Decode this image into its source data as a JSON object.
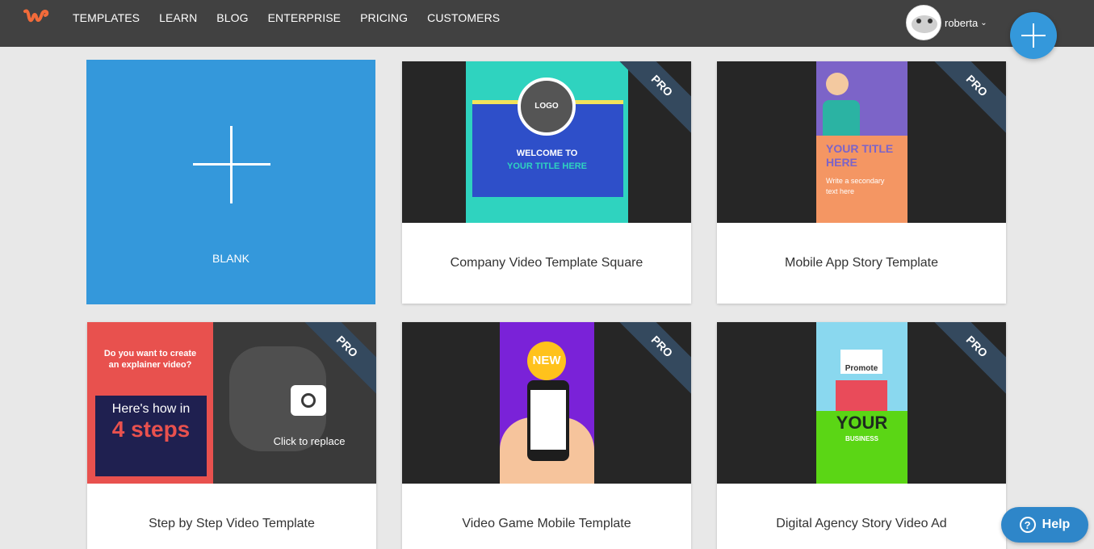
{
  "nav": {
    "items": [
      "TEMPLATES",
      "LEARN",
      "BLOG",
      "ENTERPRISE",
      "PRICING",
      "CUSTOMERS"
    ],
    "user": "roberta"
  },
  "icons": {
    "logo": "waymark-logo-icon",
    "create": "plus-icon",
    "help": "question-circle-icon"
  },
  "colors": {
    "topbar": "#414141",
    "accent": "#3498db",
    "ribbon": "#34495e",
    "logo": "#f26b3a"
  },
  "cards": {
    "blank": {
      "label": "BLANK"
    },
    "company": {
      "label": "Company Video Template Square",
      "badge": "PRO",
      "title1": "WELCOME TO",
      "title2": "YOUR TITLE HERE",
      "logo_text": "LOGO"
    },
    "mobile": {
      "label": "Mobile App Story Template",
      "badge": "PRO",
      "title": "YOUR TITLE HERE",
      "subtitle": "Write a secondary text here"
    },
    "step": {
      "label": "Step by Step Video Template",
      "badge": "PRO",
      "question": "Do you want to create an explainer video?",
      "howin": "Here's how in",
      "steps": "4 steps",
      "replace": "Click to replace"
    },
    "game": {
      "label": "Video Game Mobile Template",
      "badge": "PRO",
      "new_badge": "NEW"
    },
    "agency": {
      "label": "Digital Agency Story Video Ad",
      "badge": "PRO",
      "promote": "Promote",
      "your": "YOUR",
      "business": "BUSINESS"
    }
  },
  "help": {
    "label": "Help"
  }
}
